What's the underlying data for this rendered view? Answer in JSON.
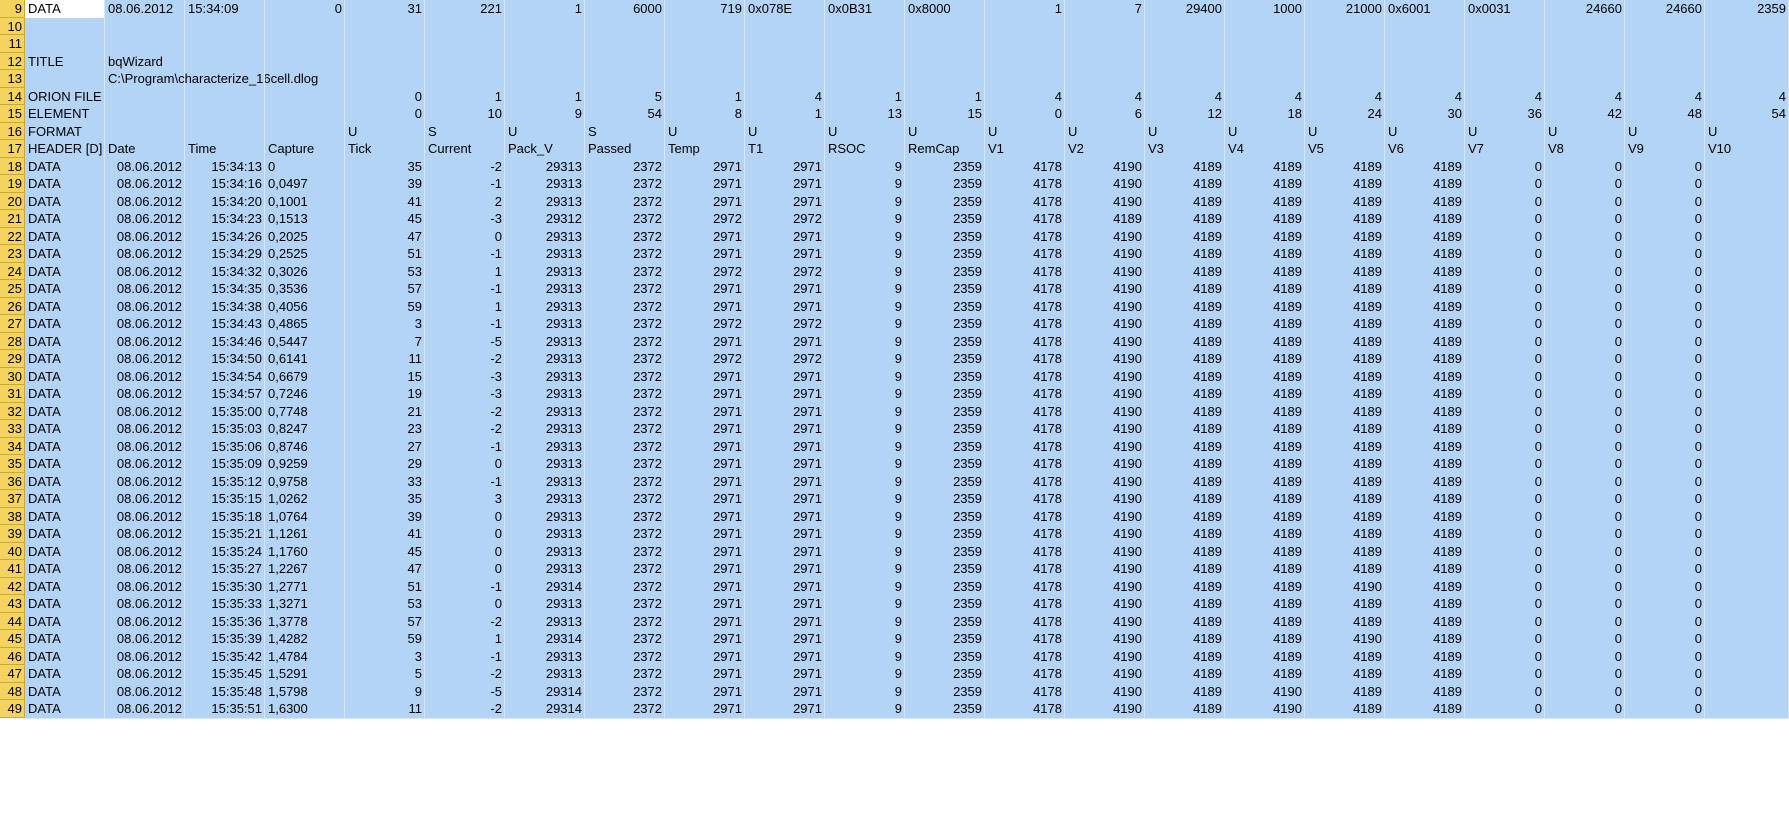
{
  "columns": [
    {
      "w": 80
    },
    {
      "w": 80
    },
    {
      "w": 80
    },
    {
      "w": 80
    },
    {
      "w": 80
    },
    {
      "w": 80
    },
    {
      "w": 80
    },
    {
      "w": 80
    },
    {
      "w": 80
    },
    {
      "w": 80
    },
    {
      "w": 80
    },
    {
      "w": 80
    },
    {
      "w": 80
    },
    {
      "w": 80
    },
    {
      "w": 80
    },
    {
      "w": 80
    },
    {
      "w": 80
    },
    {
      "w": 80
    },
    {
      "w": 80
    },
    {
      "w": 80
    },
    {
      "w": 80
    },
    {
      "w": 80
    }
  ],
  "rows": [
    {
      "n": "9",
      "cells": [
        {
          "v": "DATA",
          "t": "txt",
          "sel": true
        },
        {
          "v": "08.06.2012",
          "t": "txt"
        },
        {
          "v": "15:34:09",
          "t": "txt"
        },
        {
          "v": "0",
          "t": "num"
        },
        {
          "v": "31",
          "t": "num"
        },
        {
          "v": "221",
          "t": "num"
        },
        {
          "v": "1",
          "t": "num"
        },
        {
          "v": "6000",
          "t": "num"
        },
        {
          "v": "719",
          "t": "num"
        },
        {
          "v": "0x078E",
          "t": "txt"
        },
        {
          "v": "0x0B31",
          "t": "txt"
        },
        {
          "v": "0x8000",
          "t": "txt"
        },
        {
          "v": "1",
          "t": "num"
        },
        {
          "v": "7",
          "t": "num"
        },
        {
          "v": "29400",
          "t": "num"
        },
        {
          "v": "1000",
          "t": "num"
        },
        {
          "v": "21000",
          "t": "num"
        },
        {
          "v": "0x6001",
          "t": "txt"
        },
        {
          "v": "0x0031",
          "t": "txt"
        },
        {
          "v": "24660",
          "t": "num"
        },
        {
          "v": "24660",
          "t": "num"
        },
        {
          "v": "2359",
          "t": "num"
        }
      ]
    },
    {
      "n": "10",
      "cells": []
    },
    {
      "n": "11",
      "cells": []
    },
    {
      "n": "12",
      "cells": [
        {
          "v": "TITLE",
          "t": "txt"
        },
        {
          "v": "bqWizard",
          "t": "txt"
        }
      ]
    },
    {
      "n": "13",
      "cells": [
        {
          "v": "",
          "t": "txt"
        },
        {
          "v": "C:\\Program\\characterize_16cell.dlog",
          "t": "txt"
        }
      ]
    },
    {
      "n": "14",
      "cells": [
        {
          "v": "ORION FILE",
          "t": "txt"
        },
        {
          "v": "",
          "t": "txt"
        },
        {
          "v": "",
          "t": "txt"
        },
        {
          "v": "",
          "t": "txt"
        },
        {
          "v": "0",
          "t": "num"
        },
        {
          "v": "1",
          "t": "num"
        },
        {
          "v": "1",
          "t": "num"
        },
        {
          "v": "5",
          "t": "num"
        },
        {
          "v": "1",
          "t": "num"
        },
        {
          "v": "4",
          "t": "num"
        },
        {
          "v": "1",
          "t": "num"
        },
        {
          "v": "1",
          "t": "num"
        },
        {
          "v": "4",
          "t": "num"
        },
        {
          "v": "4",
          "t": "num"
        },
        {
          "v": "4",
          "t": "num"
        },
        {
          "v": "4",
          "t": "num"
        },
        {
          "v": "4",
          "t": "num"
        },
        {
          "v": "4",
          "t": "num"
        },
        {
          "v": "4",
          "t": "num"
        },
        {
          "v": "4",
          "t": "num"
        },
        {
          "v": "4",
          "t": "num"
        },
        {
          "v": "4",
          "t": "num"
        }
      ]
    },
    {
      "n": "15",
      "cells": [
        {
          "v": "ELEMENT",
          "t": "txt"
        },
        {
          "v": "",
          "t": "txt"
        },
        {
          "v": "",
          "t": "txt"
        },
        {
          "v": "",
          "t": "txt"
        },
        {
          "v": "0",
          "t": "num"
        },
        {
          "v": "10",
          "t": "num"
        },
        {
          "v": "9",
          "t": "num"
        },
        {
          "v": "54",
          "t": "num"
        },
        {
          "v": "8",
          "t": "num"
        },
        {
          "v": "1",
          "t": "num"
        },
        {
          "v": "13",
          "t": "num"
        },
        {
          "v": "15",
          "t": "num"
        },
        {
          "v": "0",
          "t": "num"
        },
        {
          "v": "6",
          "t": "num"
        },
        {
          "v": "12",
          "t": "num"
        },
        {
          "v": "18",
          "t": "num"
        },
        {
          "v": "24",
          "t": "num"
        },
        {
          "v": "30",
          "t": "num"
        },
        {
          "v": "36",
          "t": "num"
        },
        {
          "v": "42",
          "t": "num"
        },
        {
          "v": "48",
          "t": "num"
        },
        {
          "v": "54",
          "t": "num"
        }
      ]
    },
    {
      "n": "16",
      "cells": [
        {
          "v": "FORMAT",
          "t": "txt"
        },
        {
          "v": "",
          "t": "txt"
        },
        {
          "v": "",
          "t": "txt"
        },
        {
          "v": "",
          "t": "txt"
        },
        {
          "v": "U",
          "t": "txt"
        },
        {
          "v": "S",
          "t": "txt"
        },
        {
          "v": "U",
          "t": "txt"
        },
        {
          "v": "S",
          "t": "txt"
        },
        {
          "v": "U",
          "t": "txt"
        },
        {
          "v": "U",
          "t": "txt"
        },
        {
          "v": "U",
          "t": "txt"
        },
        {
          "v": "U",
          "t": "txt"
        },
        {
          "v": "U",
          "t": "txt"
        },
        {
          "v": "U",
          "t": "txt"
        },
        {
          "v": "U",
          "t": "txt"
        },
        {
          "v": "U",
          "t": "txt"
        },
        {
          "v": "U",
          "t": "txt"
        },
        {
          "v": "U",
          "t": "txt"
        },
        {
          "v": "U",
          "t": "txt"
        },
        {
          "v": "U",
          "t": "txt"
        },
        {
          "v": "U",
          "t": "txt"
        },
        {
          "v": "U",
          "t": "txt"
        }
      ]
    },
    {
      "n": "17",
      "cells": [
        {
          "v": "HEADER [D]",
          "t": "txt"
        },
        {
          "v": "Date",
          "t": "txt"
        },
        {
          "v": "Time",
          "t": "txt"
        },
        {
          "v": "Capture",
          "t": "txt"
        },
        {
          "v": "Tick",
          "t": "txt"
        },
        {
          "v": "Current",
          "t": "txt"
        },
        {
          "v": "Pack_V",
          "t": "txt"
        },
        {
          "v": "Passed",
          "t": "txt"
        },
        {
          "v": "Temp",
          "t": "txt"
        },
        {
          "v": "T1",
          "t": "txt"
        },
        {
          "v": "RSOC",
          "t": "txt"
        },
        {
          "v": "RemCap",
          "t": "txt"
        },
        {
          "v": "V1",
          "t": "txt"
        },
        {
          "v": "V2",
          "t": "txt"
        },
        {
          "v": "V3",
          "t": "txt"
        },
        {
          "v": "V4",
          "t": "txt"
        },
        {
          "v": "V5",
          "t": "txt"
        },
        {
          "v": "V6",
          "t": "txt"
        },
        {
          "v": "V7",
          "t": "txt"
        },
        {
          "v": "V8",
          "t": "txt"
        },
        {
          "v": "V9",
          "t": "txt"
        },
        {
          "v": "V10",
          "t": "txt"
        }
      ]
    }
  ],
  "data_rows": [
    [
      "18",
      "DATA",
      "08.06.2012",
      "15:34:13",
      "0",
      "35",
      "-2",
      "29313",
      "2372",
      "2971",
      "2971",
      "9",
      "2359",
      "4178",
      "4190",
      "4189",
      "4189",
      "4189",
      "4189",
      "0",
      "0",
      "0"
    ],
    [
      "19",
      "DATA",
      "08.06.2012",
      "15:34:16",
      "0,0497",
      "39",
      "-1",
      "29313",
      "2372",
      "2971",
      "2971",
      "9",
      "2359",
      "4178",
      "4190",
      "4189",
      "4189",
      "4189",
      "4189",
      "0",
      "0",
      "0"
    ],
    [
      "20",
      "DATA",
      "08.06.2012",
      "15:34:20",
      "0,1001",
      "41",
      "2",
      "29313",
      "2372",
      "2971",
      "2971",
      "9",
      "2359",
      "4178",
      "4190",
      "4189",
      "4189",
      "4189",
      "4189",
      "0",
      "0",
      "0"
    ],
    [
      "21",
      "DATA",
      "08.06.2012",
      "15:34:23",
      "0,1513",
      "45",
      "-3",
      "29312",
      "2372",
      "2972",
      "2972",
      "9",
      "2359",
      "4178",
      "4189",
      "4189",
      "4189",
      "4189",
      "4189",
      "0",
      "0",
      "0"
    ],
    [
      "22",
      "DATA",
      "08.06.2012",
      "15:34:26",
      "0,2025",
      "47",
      "0",
      "29313",
      "2372",
      "2971",
      "2971",
      "9",
      "2359",
      "4178",
      "4190",
      "4189",
      "4189",
      "4189",
      "4189",
      "0",
      "0",
      "0"
    ],
    [
      "23",
      "DATA",
      "08.06.2012",
      "15:34:29",
      "0,2525",
      "51",
      "-1",
      "29313",
      "2372",
      "2971",
      "2971",
      "9",
      "2359",
      "4178",
      "4190",
      "4189",
      "4189",
      "4189",
      "4189",
      "0",
      "0",
      "0"
    ],
    [
      "24",
      "DATA",
      "08.06.2012",
      "15:34:32",
      "0,3026",
      "53",
      "1",
      "29313",
      "2372",
      "2972",
      "2972",
      "9",
      "2359",
      "4178",
      "4190",
      "4189",
      "4189",
      "4189",
      "4189",
      "0",
      "0",
      "0"
    ],
    [
      "25",
      "DATA",
      "08.06.2012",
      "15:34:35",
      "0,3536",
      "57",
      "-1",
      "29313",
      "2372",
      "2971",
      "2971",
      "9",
      "2359",
      "4178",
      "4190",
      "4189",
      "4189",
      "4189",
      "4189",
      "0",
      "0",
      "0"
    ],
    [
      "26",
      "DATA",
      "08.06.2012",
      "15:34:38",
      "0,4056",
      "59",
      "1",
      "29313",
      "2372",
      "2971",
      "2971",
      "9",
      "2359",
      "4178",
      "4190",
      "4189",
      "4189",
      "4189",
      "4189",
      "0",
      "0",
      "0"
    ],
    [
      "27",
      "DATA",
      "08.06.2012",
      "15:34:43",
      "0,4865",
      "3",
      "-1",
      "29313",
      "2372",
      "2972",
      "2972",
      "9",
      "2359",
      "4178",
      "4190",
      "4189",
      "4189",
      "4189",
      "4189",
      "0",
      "0",
      "0"
    ],
    [
      "28",
      "DATA",
      "08.06.2012",
      "15:34:46",
      "0,5447",
      "7",
      "-5",
      "29313",
      "2372",
      "2971",
      "2971",
      "9",
      "2359",
      "4178",
      "4190",
      "4189",
      "4189",
      "4189",
      "4189",
      "0",
      "0",
      "0"
    ],
    [
      "29",
      "DATA",
      "08.06.2012",
      "15:34:50",
      "0,6141",
      "11",
      "-2",
      "29313",
      "2372",
      "2972",
      "2972",
      "9",
      "2359",
      "4178",
      "4190",
      "4189",
      "4189",
      "4189",
      "4189",
      "0",
      "0",
      "0"
    ],
    [
      "30",
      "DATA",
      "08.06.2012",
      "15:34:54",
      "0,6679",
      "15",
      "-3",
      "29313",
      "2372",
      "2971",
      "2971",
      "9",
      "2359",
      "4178",
      "4190",
      "4189",
      "4189",
      "4189",
      "4189",
      "0",
      "0",
      "0"
    ],
    [
      "31",
      "DATA",
      "08.06.2012",
      "15:34:57",
      "0,7246",
      "19",
      "-3",
      "29313",
      "2372",
      "2971",
      "2971",
      "9",
      "2359",
      "4178",
      "4190",
      "4189",
      "4189",
      "4189",
      "4189",
      "0",
      "0",
      "0"
    ],
    [
      "32",
      "DATA",
      "08.06.2012",
      "15:35:00",
      "0,7748",
      "21",
      "-2",
      "29313",
      "2372",
      "2971",
      "2971",
      "9",
      "2359",
      "4178",
      "4190",
      "4189",
      "4189",
      "4189",
      "4189",
      "0",
      "0",
      "0"
    ],
    [
      "33",
      "DATA",
      "08.06.2012",
      "15:35:03",
      "0,8247",
      "23",
      "-2",
      "29313",
      "2372",
      "2971",
      "2971",
      "9",
      "2359",
      "4178",
      "4190",
      "4189",
      "4189",
      "4189",
      "4189",
      "0",
      "0",
      "0"
    ],
    [
      "34",
      "DATA",
      "08.06.2012",
      "15:35:06",
      "0,8746",
      "27",
      "-1",
      "29313",
      "2372",
      "2971",
      "2971",
      "9",
      "2359",
      "4178",
      "4190",
      "4189",
      "4189",
      "4189",
      "4189",
      "0",
      "0",
      "0"
    ],
    [
      "35",
      "DATA",
      "08.06.2012",
      "15:35:09",
      "0,9259",
      "29",
      "0",
      "29313",
      "2372",
      "2971",
      "2971",
      "9",
      "2359",
      "4178",
      "4190",
      "4189",
      "4189",
      "4189",
      "4189",
      "0",
      "0",
      "0"
    ],
    [
      "36",
      "DATA",
      "08.06.2012",
      "15:35:12",
      "0,9758",
      "33",
      "-1",
      "29313",
      "2372",
      "2971",
      "2971",
      "9",
      "2359",
      "4178",
      "4190",
      "4189",
      "4189",
      "4189",
      "4189",
      "0",
      "0",
      "0"
    ],
    [
      "37",
      "DATA",
      "08.06.2012",
      "15:35:15",
      "1,0262",
      "35",
      "3",
      "29313",
      "2372",
      "2971",
      "2971",
      "9",
      "2359",
      "4178",
      "4190",
      "4189",
      "4189",
      "4189",
      "4189",
      "0",
      "0",
      "0"
    ],
    [
      "38",
      "DATA",
      "08.06.2012",
      "15:35:18",
      "1,0764",
      "39",
      "0",
      "29313",
      "2372",
      "2971",
      "2971",
      "9",
      "2359",
      "4178",
      "4190",
      "4189",
      "4189",
      "4189",
      "4189",
      "0",
      "0",
      "0"
    ],
    [
      "39",
      "DATA",
      "08.06.2012",
      "15:35:21",
      "1,1261",
      "41",
      "0",
      "29313",
      "2372",
      "2971",
      "2971",
      "9",
      "2359",
      "4178",
      "4190",
      "4189",
      "4189",
      "4189",
      "4189",
      "0",
      "0",
      "0"
    ],
    [
      "40",
      "DATA",
      "08.06.2012",
      "15:35:24",
      "1,1760",
      "45",
      "0",
      "29313",
      "2372",
      "2971",
      "2971",
      "9",
      "2359",
      "4178",
      "4190",
      "4189",
      "4189",
      "4189",
      "4189",
      "0",
      "0",
      "0"
    ],
    [
      "41",
      "DATA",
      "08.06.2012",
      "15:35:27",
      "1,2267",
      "47",
      "0",
      "29313",
      "2372",
      "2971",
      "2971",
      "9",
      "2359",
      "4178",
      "4190",
      "4189",
      "4189",
      "4189",
      "4189",
      "0",
      "0",
      "0"
    ],
    [
      "42",
      "DATA",
      "08.06.2012",
      "15:35:30",
      "1,2771",
      "51",
      "-1",
      "29314",
      "2372",
      "2971",
      "2971",
      "9",
      "2359",
      "4178",
      "4190",
      "4189",
      "4189",
      "4190",
      "4189",
      "0",
      "0",
      "0"
    ],
    [
      "43",
      "DATA",
      "08.06.2012",
      "15:35:33",
      "1,3271",
      "53",
      "0",
      "29313",
      "2372",
      "2971",
      "2971",
      "9",
      "2359",
      "4178",
      "4190",
      "4189",
      "4189",
      "4189",
      "4189",
      "0",
      "0",
      "0"
    ],
    [
      "44",
      "DATA",
      "08.06.2012",
      "15:35:36",
      "1,3778",
      "57",
      "-2",
      "29313",
      "2372",
      "2971",
      "2971",
      "9",
      "2359",
      "4178",
      "4190",
      "4189",
      "4189",
      "4189",
      "4189",
      "0",
      "0",
      "0"
    ],
    [
      "45",
      "DATA",
      "08.06.2012",
      "15:35:39",
      "1,4282",
      "59",
      "1",
      "29314",
      "2372",
      "2971",
      "2971",
      "9",
      "2359",
      "4178",
      "4190",
      "4189",
      "4189",
      "4190",
      "4189",
      "0",
      "0",
      "0"
    ],
    [
      "46",
      "DATA",
      "08.06.2012",
      "15:35:42",
      "1,4784",
      "3",
      "-1",
      "29313",
      "2372",
      "2971",
      "2971",
      "9",
      "2359",
      "4178",
      "4190",
      "4189",
      "4189",
      "4189",
      "4189",
      "0",
      "0",
      "0"
    ],
    [
      "47",
      "DATA",
      "08.06.2012",
      "15:35:45",
      "1,5291",
      "5",
      "-2",
      "29313",
      "2372",
      "2971",
      "2971",
      "9",
      "2359",
      "4178",
      "4190",
      "4189",
      "4189",
      "4189",
      "4189",
      "0",
      "0",
      "0"
    ],
    [
      "48",
      "DATA",
      "08.06.2012",
      "15:35:48",
      "1,5798",
      "9",
      "-5",
      "29314",
      "2372",
      "2971",
      "2971",
      "9",
      "2359",
      "4178",
      "4190",
      "4189",
      "4190",
      "4189",
      "4189",
      "0",
      "0",
      "0"
    ],
    [
      "49",
      "DATA",
      "08.06.2012",
      "15:35:51",
      "1,6300",
      "11",
      "-2",
      "29314",
      "2372",
      "2971",
      "2971",
      "9",
      "2359",
      "4178",
      "4190",
      "4189",
      "4190",
      "4189",
      "4189",
      "0",
      "0",
      "0"
    ]
  ]
}
